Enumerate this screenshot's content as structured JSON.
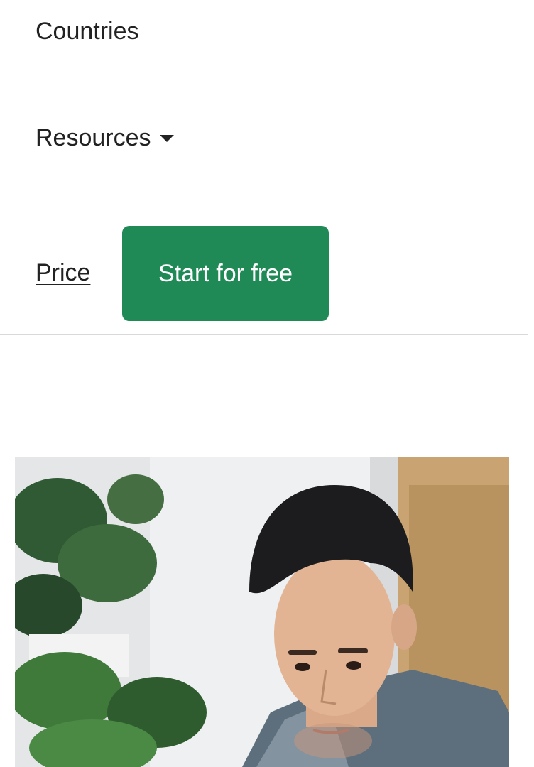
{
  "nav": {
    "countries_label": "Countries",
    "resources_label": "Resources",
    "price_label": "Price",
    "start_button_label": "Start for free"
  },
  "hero": {
    "image": "man-with-plants-photo"
  },
  "colors": {
    "accent": "#1f8a55",
    "text": "#222222",
    "divider": "#d9d9d9"
  }
}
